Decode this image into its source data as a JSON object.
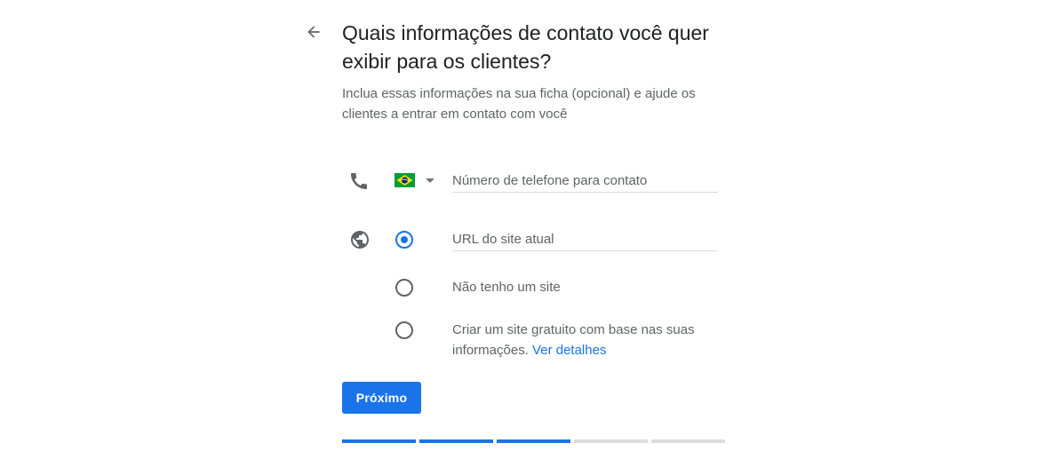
{
  "header": {
    "back_icon": "arrow-back-icon",
    "title": "Quais informações de contato você quer exibir para os clientes?",
    "subtitle": "Inclua essas informações na sua ficha (opcional) e ajude os clientes a entrar em contato com você"
  },
  "phone": {
    "icon": "phone-icon",
    "country_flag": "brazil-flag-icon",
    "placeholder": "Número de telefone para contato",
    "value": ""
  },
  "website": {
    "icon": "globe-icon",
    "options": [
      {
        "label": "",
        "selected": true
      },
      {
        "label": "Não tenho um site",
        "selected": false
      },
      {
        "label": "Criar um site gratuito com base nas suas informações.",
        "link": "Ver detalhes",
        "selected": false
      }
    ],
    "url_placeholder": "URL do site atual",
    "url_value": ""
  },
  "actions": {
    "next_label": "Próximo"
  },
  "progress": {
    "total_steps": 5,
    "completed_steps": 3
  },
  "colors": {
    "accent": "#1a73e8",
    "text_primary": "#202124",
    "text_secondary": "#5f6368",
    "divider": "#dadce0"
  }
}
